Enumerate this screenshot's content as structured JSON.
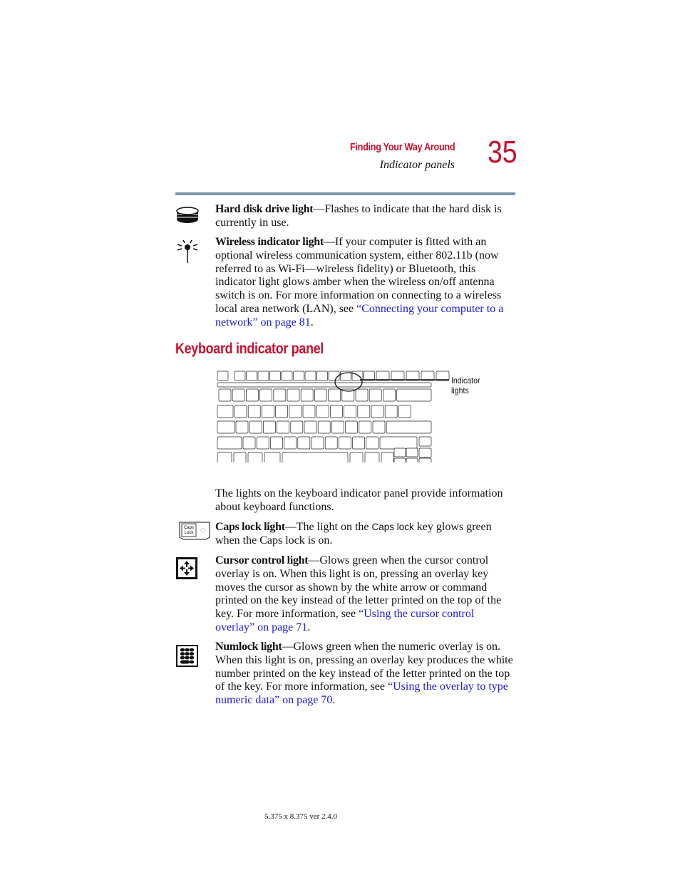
{
  "header": {
    "chapter_title": "Finding Your Way Around",
    "section_title": "Indicator panels",
    "page_number": "35"
  },
  "items_top": [
    {
      "icon": "hard-disk-icon",
      "term": "Hard disk drive light",
      "text": "—Flashes to indicate that the hard disk is currently in use."
    },
    {
      "icon": "wireless-icon",
      "term": "Wireless indicator light",
      "text": "—If your computer is fitted with an optional wireless communication system, either 802.11b (now referred to as Wi-Fi—wireless fidelity) or Bluetooth, this indicator light glows amber when the wireless on/off antenna switch is on. For more information on connecting to a wireless local area network (LAN), see ",
      "link": "“Connecting your computer to a network” on page 81",
      "after": "."
    }
  ],
  "section": {
    "heading": "Keyboard indicator panel",
    "figure_callout_line1": "Indicator",
    "figure_callout_line2": "lights",
    "intro": "The lights on the keyboard indicator panel provide information about keyboard functions."
  },
  "items_bottom": [
    {
      "icon": "caps-lock-key-icon",
      "term": "Caps lock light",
      "text_before": "—The light on the ",
      "key_name": "Caps lock",
      "text_after": " key glows green when the Caps lock is on."
    },
    {
      "icon": "cursor-control-icon",
      "term": "Cursor control light",
      "text": "—Glows green when the cursor control overlay is on. When this light is on, pressing an overlay key moves the cursor as shown by the white arrow or command printed on the key instead of the letter printed on the top of the key. For more information, see ",
      "link": "“Using the cursor control overlay” on page 71",
      "after": "."
    },
    {
      "icon": "numlock-icon",
      "term": "Numlock light",
      "text": "—Glows green when the numeric overlay is on. When this light is on, pressing an overlay key produces the white number printed on the key instead of the letter printed on the top of the key. For more information, see ",
      "link": "“Using the overlay to type numeric data” on page 70",
      "after": "."
    }
  ],
  "caps_key_label_line1": "Caps",
  "caps_key_label_line2": "Lock",
  "footer": "5.375 x 8.375 ver 2.4.0",
  "colors": {
    "accent_red": "#c8102e",
    "rule_blue": "#7a96b0",
    "link_blue": "#1a1adb"
  }
}
